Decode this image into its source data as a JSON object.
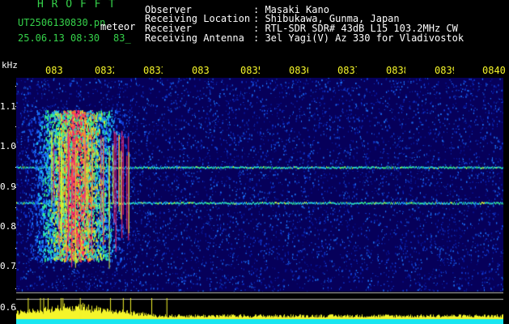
{
  "header": {
    "app_name": "H R O F F T",
    "file_name": "UT2506130830.pn",
    "mode_label": "meteor",
    "datetime": "25.06.13 08:30",
    "count_label": "83_"
  },
  "station": {
    "rows": [
      {
        "label": "Observer",
        "value": ": Masaki Kano"
      },
      {
        "label": "Receiving Location",
        "value": ": Shibukawa, Gunma, Japan"
      },
      {
        "label": "Receiver",
        "value": ": RTL-SDR SDR# 43dB L15 103.2MHz CW"
      },
      {
        "label": "Receiving Antenna",
        "value": ": 3el Yagi(V) Az 330 for Vladivostok"
      }
    ]
  },
  "axes": {
    "y_unit": "kHz",
    "y_ticks": [
      "1.1",
      "1.0",
      "0.9",
      "0.8",
      "0.7",
      "0.6"
    ],
    "x_ticks": [
      "083",
      "0832",
      "0833",
      "083",
      "0835",
      "0836",
      "0837",
      "0838",
      "0839",
      "0840"
    ]
  },
  "colors": {
    "background": "#000000",
    "spectrogram_base": "#06005a",
    "title_green": "#35d24a",
    "label_yellow": "#f5f52a",
    "text_white": "#ffffff",
    "level_cyan": "#18e6f0"
  }
}
